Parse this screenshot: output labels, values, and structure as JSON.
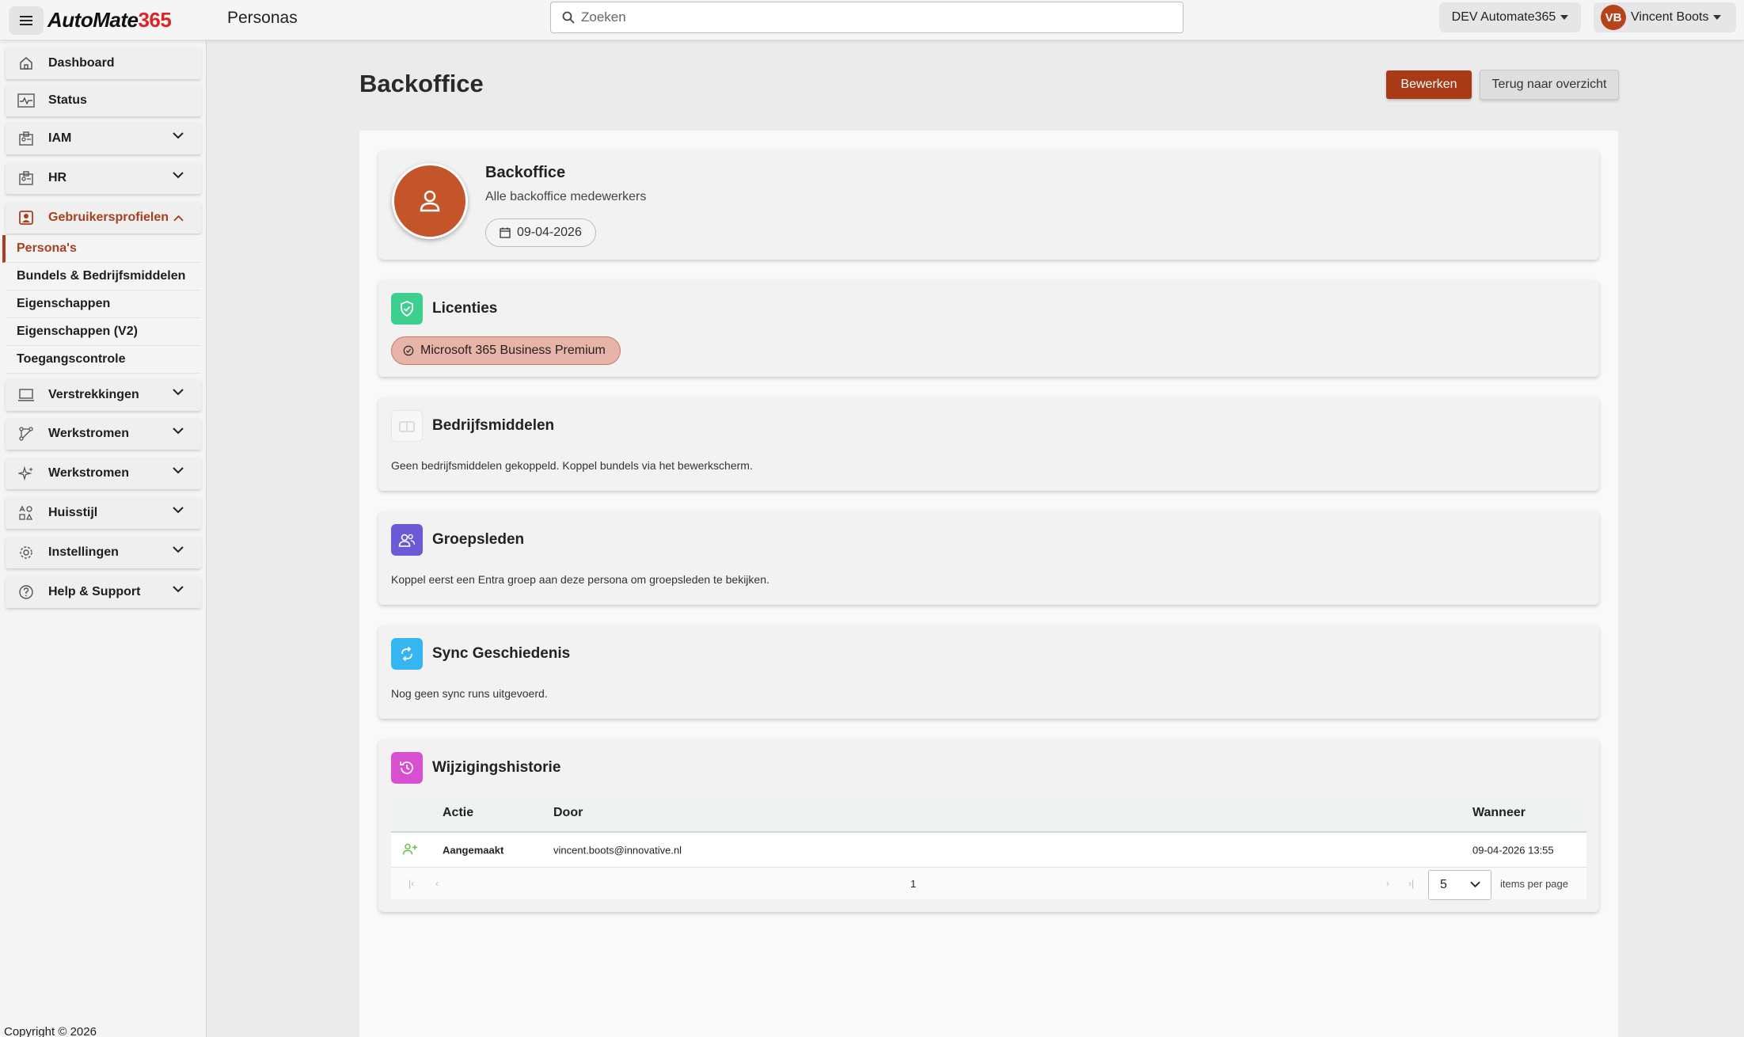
{
  "header": {
    "logo_part1": "AutoMate",
    "logo_part2": "365",
    "page_title": "Personas",
    "search_placeholder": "Zoeken",
    "environment": "DEV Automate365",
    "user_initials": "VB",
    "user_name": "Vincent Boots"
  },
  "sidebar": {
    "items": [
      {
        "label": "Dashboard",
        "icon": "home-icon"
      },
      {
        "label": "Status",
        "icon": "status-icon"
      },
      {
        "label": "IAM",
        "icon": "id-card-icon"
      },
      {
        "label": "HR",
        "icon": "id-card-icon"
      },
      {
        "label": "Gebruikersprofielen",
        "icon": "user-profile-icon"
      },
      {
        "label": "Verstrekkingen",
        "icon": "laptop-icon"
      },
      {
        "label": "Werkstromen",
        "icon": "workflow-icon"
      },
      {
        "label": "Werkstromen",
        "icon": "sparkle-icon"
      },
      {
        "label": "Huisstijl",
        "icon": "style-icon"
      },
      {
        "label": "Instellingen",
        "icon": "gear-icon"
      },
      {
        "label": "Help & Support",
        "icon": "help-icon"
      }
    ],
    "sub_items": [
      {
        "label": "Persona's"
      },
      {
        "label": "Bundels & Bedrijfsmiddelen"
      },
      {
        "label": "Eigenschappen"
      },
      {
        "label": "Eigenschappen (V2)"
      },
      {
        "label": "Toegangscontrole"
      }
    ],
    "copyright": "Copyright © 2026"
  },
  "main": {
    "title": "Backoffice",
    "edit_label": "Bewerken",
    "back_label": "Terug naar overzicht",
    "profile": {
      "name": "Backoffice",
      "description": "Alle backoffice medewerkers",
      "date": "09-04-2026"
    },
    "licenses": {
      "title": "Licenties",
      "chip": "Microsoft 365 Business Premium"
    },
    "assets": {
      "title": "Bedrijfsmiddelen",
      "text": "Geen bedrijfsmiddelen gekoppeld. Koppel bundels via het bewerkscherm."
    },
    "members": {
      "title": "Groepsleden",
      "text": "Koppel eerst een Entra groep aan deze persona om groepsleden te bekijken."
    },
    "sync": {
      "title": "Sync Geschiedenis",
      "text": "Nog geen sync runs uitgevoerd."
    },
    "history": {
      "title": "Wijzigingshistorie",
      "columns": {
        "action": "Actie",
        "by": "Door",
        "when": "Wanneer"
      },
      "rows": [
        {
          "action": "Aangemaakt",
          "by": "vincent.boots@innovative.nl",
          "when": "09-04-2026 13:55"
        }
      ],
      "page": "1",
      "page_size": "5",
      "items_per_page": "items per page"
    }
  },
  "colors": {
    "accent": "#a83b16",
    "license_icon": "#3ccf8e",
    "members_icon": "#6a5ad6",
    "sync_icon": "#36b6f0",
    "history_icon": "#d94fd1"
  }
}
